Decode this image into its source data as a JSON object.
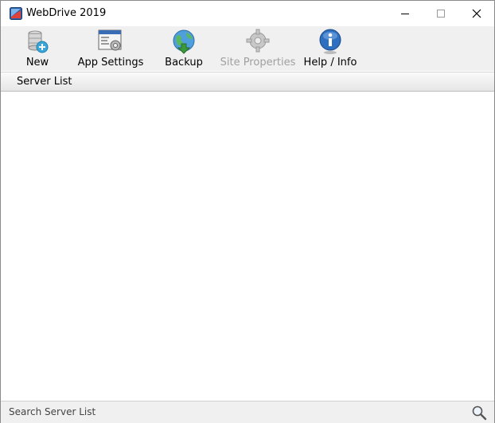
{
  "window": {
    "title": "WebDrive 2019",
    "icon": "webdrive-app-icon",
    "controls": {
      "minimize": "minimize-icon",
      "maximize": "maximize-icon",
      "close": "close-icon"
    }
  },
  "toolbar": {
    "items": [
      {
        "label": "New",
        "icon": "new-server-icon",
        "enabled": true
      },
      {
        "label": "App Settings",
        "icon": "app-settings-icon",
        "enabled": true
      },
      {
        "label": "Backup",
        "icon": "backup-globe-icon",
        "enabled": true
      },
      {
        "label": "Site Properties",
        "icon": "site-properties-gear-icon",
        "enabled": false
      },
      {
        "label": "Help / Info",
        "icon": "help-info-icon",
        "enabled": true
      }
    ]
  },
  "server_list": {
    "title": "Server List",
    "items": []
  },
  "search": {
    "placeholder": "Search Server List",
    "value": "",
    "icon": "magnifier-icon"
  },
  "colors": {
    "toolbar_bg": "#f0f0f0",
    "disabled_text": "#a0a0a0",
    "accent_blue": "#1e6fc4",
    "accent_green": "#3a9a3a"
  }
}
